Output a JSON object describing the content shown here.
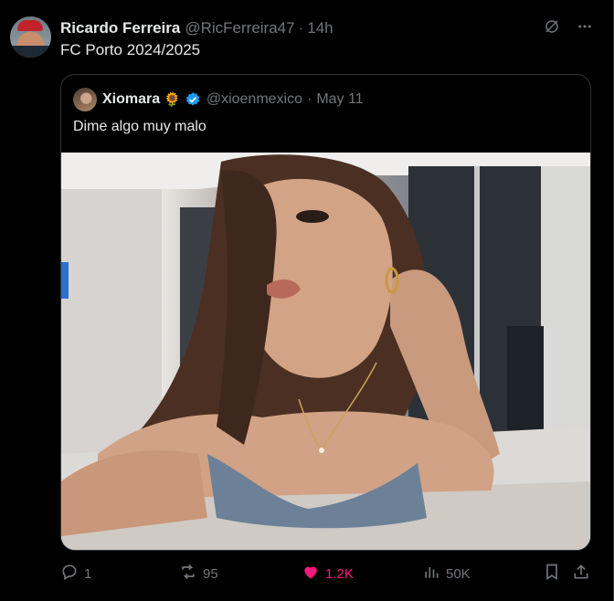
{
  "tweet": {
    "author_name": "Ricardo Ferreira",
    "author_handle": "@RicFerreira47",
    "separator": "·",
    "time": "14h",
    "text": "FC Porto 2024/2025"
  },
  "quoted_tweet": {
    "author_name": "Xiomara",
    "author_emoji": "🌻",
    "author_handle": "@xioenmexico",
    "separator": "·",
    "date": "May 11",
    "text": "Dime algo muy malo",
    "verified_color": "#1d9bf0"
  },
  "actions": {
    "reply_count": "1",
    "retweet_count": "95",
    "like_count": "1.2K",
    "views_count": "50K"
  },
  "colors": {
    "background": "#000000",
    "primary_text": "#e7e9ea",
    "secondary_text": "#71767b",
    "like": "#f91880",
    "border": "#2f3336"
  },
  "icons": {
    "header": [
      "grok-icon",
      "more-icon"
    ],
    "actions": [
      "reply-icon",
      "retweet-icon",
      "heart-icon",
      "views-icon",
      "bookmark-icon",
      "share-icon"
    ]
  }
}
